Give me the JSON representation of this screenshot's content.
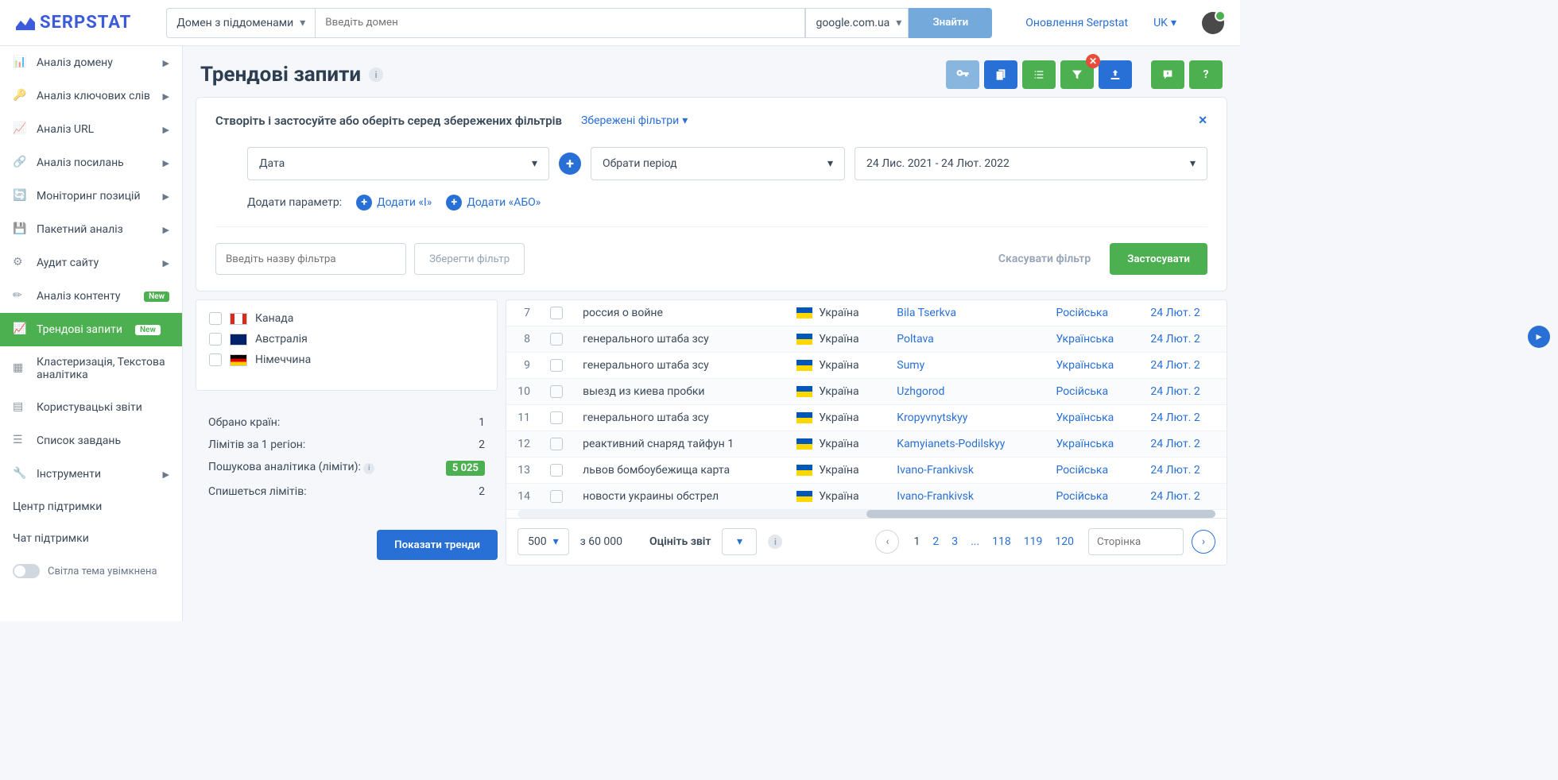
{
  "top": {
    "logo": "SERPSTAT",
    "domain_mode": "Домен з піддоменами",
    "domain_placeholder": "Введіть домен",
    "region": "google.com.ua",
    "find": "Знайти",
    "update_link": "Оновлення Serpstat",
    "lang": "UK"
  },
  "sidebar": {
    "items": [
      {
        "label": "Аналіз домену",
        "arrow": true
      },
      {
        "label": "Аналіз ключових слів",
        "arrow": true
      },
      {
        "label": "Аналіз URL",
        "arrow": true
      },
      {
        "label": "Аналіз посилань",
        "arrow": true
      },
      {
        "label": "Моніторинг позицій",
        "arrow": true
      },
      {
        "label": "Пакетний аналіз",
        "arrow": true
      },
      {
        "label": "Аудит сайту",
        "arrow": true
      },
      {
        "label": "Аналіз контенту",
        "arrow": true,
        "new": true
      },
      {
        "label": "Трендові запити",
        "active": true,
        "new": true
      },
      {
        "label": "Кластеризація, Текстова аналітика"
      },
      {
        "label": "Користувацькі звіти"
      },
      {
        "label": "Список завдань"
      },
      {
        "label": "Інструменти",
        "arrow": true
      }
    ],
    "support": "Центр підтримки",
    "chat": "Чат підтримки",
    "theme": "Світла тема увімкнена"
  },
  "page": {
    "title": "Трендові запити"
  },
  "filter": {
    "title": "Створіть і застосуйте або оберіть серед збережених фільтрів",
    "saved": "Збережені фільтри",
    "date": "Дата",
    "period": "Обрати період",
    "range": "24 Лис. 2021 - 24 Лют. 2022",
    "add_param": "Додати параметр:",
    "add_and": "Додати «І»",
    "add_or": "Додати «АБО»",
    "name_placeholder": "Введіть назву фільтра",
    "save": "Зберегти фільтр",
    "cancel": "Скасувати фільтр",
    "apply": "Застосувати"
  },
  "countries": [
    {
      "label": "Канада"
    },
    {
      "label": "Австралія"
    },
    {
      "label": "Німеччина"
    }
  ],
  "stats": {
    "selected_label": "Обрано країн:",
    "selected": "1",
    "region_limit_label": "Лімітів за 1 регіон:",
    "region_limit": "2",
    "search_limit_label": "Пошукова аналітика (ліміти):",
    "search_limit": "5 025",
    "spent_label": "Спишеться лімітів:",
    "spent": "2",
    "show_btn": "Показати тренди"
  },
  "rows": [
    {
      "n": "7",
      "kw": "россия о войне",
      "country": "Україна",
      "city": "Bila Tserkva",
      "lang": "Російська",
      "date": "24 Лют. 2"
    },
    {
      "n": "8",
      "kw": "генерального штаба зсу",
      "country": "Україна",
      "city": "Poltava",
      "lang": "Українська",
      "date": "24 Лют. 2"
    },
    {
      "n": "9",
      "kw": "генерального штаба зсу",
      "country": "Україна",
      "city": "Sumy",
      "lang": "Українська",
      "date": "24 Лют. 2"
    },
    {
      "n": "10",
      "kw": "выезд из киева пробки",
      "country": "Україна",
      "city": "Uzhgorod",
      "lang": "Російська",
      "date": "24 Лют. 2"
    },
    {
      "n": "11",
      "kw": "генерального штаба зсу",
      "country": "Україна",
      "city": "Kropyvnytskyy",
      "lang": "Українська",
      "date": "24 Лют. 2"
    },
    {
      "n": "12",
      "kw": "реактивний снаряд тайфун 1",
      "country": "Україна",
      "city": "Kamyianets-Podilskyy",
      "lang": "Українська",
      "date": "24 Лют. 2"
    },
    {
      "n": "13",
      "kw": "львов бомбоубежища карта",
      "country": "Україна",
      "city": "Ivano-Frankivsk",
      "lang": "Російська",
      "date": "24 Лют. 2"
    },
    {
      "n": "14",
      "kw": "новости украины обстрел",
      "country": "Україна",
      "city": "Ivano-Frankivsk",
      "lang": "Російська",
      "date": "24 Лют. 2"
    }
  ],
  "pagi": {
    "per_page": "500",
    "total": "з 60 000",
    "rate": "Оцініть звіт",
    "pages": [
      "1",
      "2",
      "3",
      "...",
      "118",
      "119",
      "120"
    ],
    "page_placeholder": "Сторінка"
  }
}
